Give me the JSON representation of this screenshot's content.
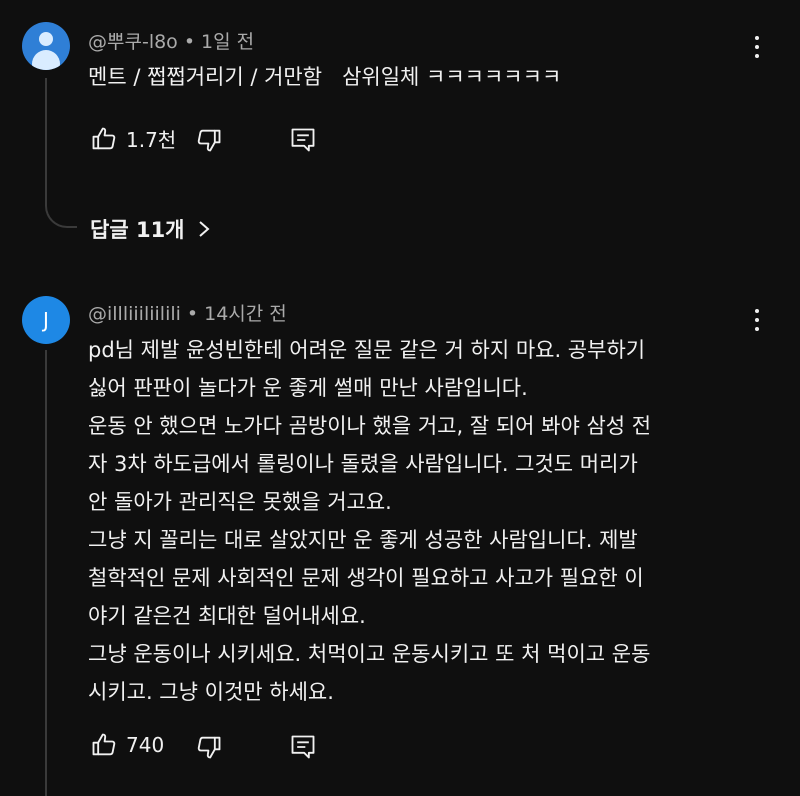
{
  "comments": [
    {
      "author": "@뿌쿠-l8o",
      "time": "1일 전",
      "text": "멘트 / 쩝쩝거리기 / 거만함   삼위일체 ㅋㅋㅋㅋㅋㅋㅋ",
      "likes": "1.7천",
      "avatar_icon": "person-icon",
      "replies_label": "답글 11개"
    },
    {
      "author": "@illliiiliilili",
      "time": "14시간 전",
      "avatar_letter": "J",
      "text": "pd님 제발 윤성빈한테 어려운 질문 같은 거 하지 마요. 공부하기\n싫어 판판이 놀다가 운 좋게 썰매 만난 사람입니다.\n운동 안 했으면 노가다 곰방이나 했을 거고, 잘 되어 봐야 삼성 전\n자 3차 하도급에서 롤링이나 돌렸을 사람입니다. 그것도 머리가\n안 돌아가 관리직은 못했을 거고요.\n그냥 지 꼴리는 대로 살았지만 운 좋게 성공한 사람입니다. 제발\n철학적인 문제 사회적인 문제 생각이 필요하고 사고가 필요한 이\n야기 같은건 최대한 덜어내세요.\n그냥 운동이나 시키세요. 처먹이고 운동시키고 또 처 먹이고 운동\n시키고. 그냥 이것만 하세요.",
      "likes": "740"
    }
  ],
  "colors": {
    "background": "#0f0f0f",
    "text": "#f1f1f1",
    "meta": "#aaaaaa",
    "avatar": "#1e88e5"
  }
}
